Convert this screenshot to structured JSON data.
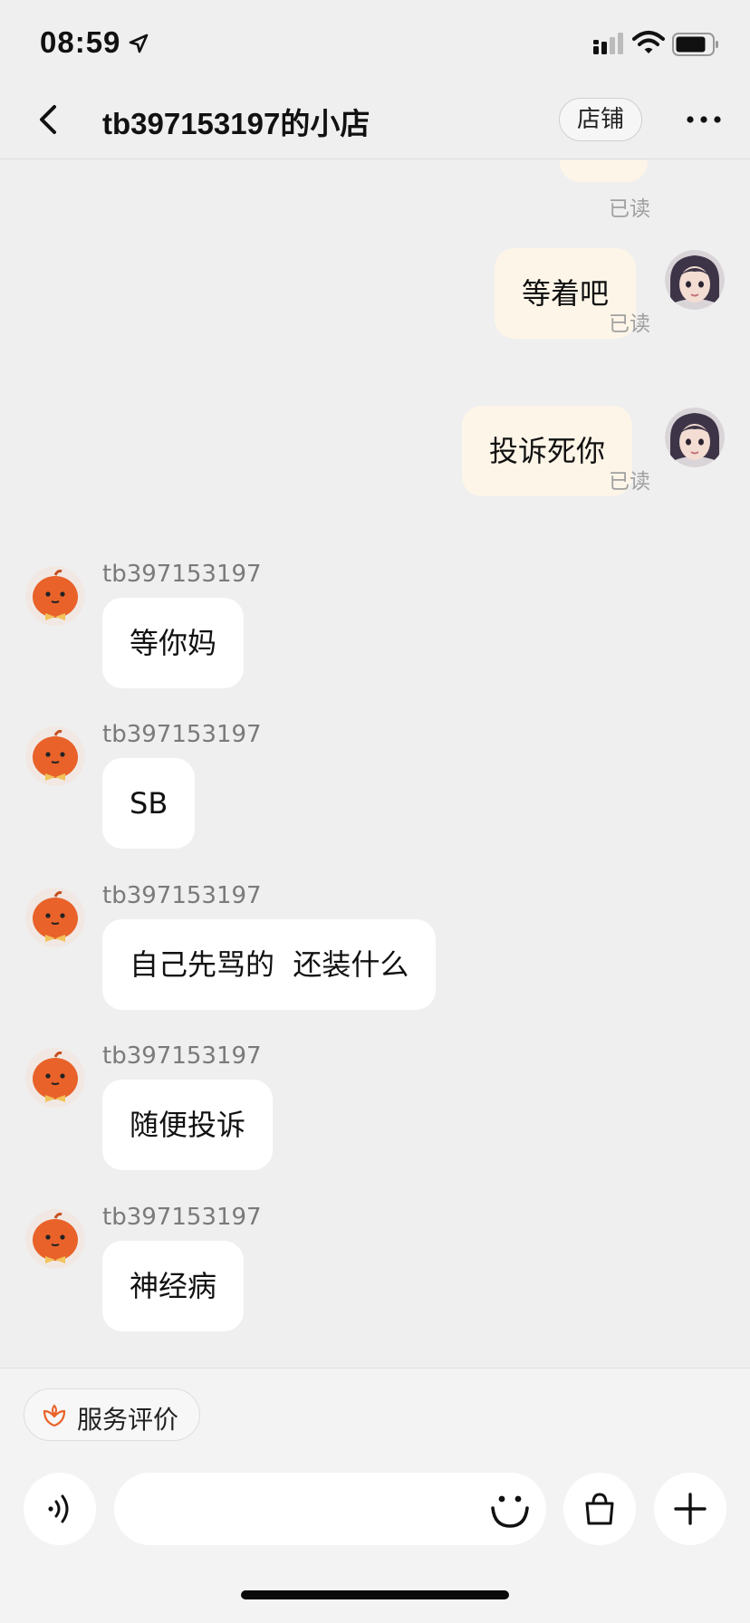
{
  "status_bar": {
    "time": "08:59"
  },
  "header": {
    "title": "tb397153197的小店",
    "shop_button": "店铺"
  },
  "messages": {
    "mine": [
      {
        "text": "",
        "read": "已读"
      },
      {
        "text": "等着吧",
        "read": "已读"
      },
      {
        "text": "投诉死你",
        "read": "已读"
      }
    ],
    "theirs": [
      {
        "sender": "tb397153197",
        "text": "等你妈"
      },
      {
        "sender": "tb397153197",
        "text": "SB"
      },
      {
        "sender": "tb397153197",
        "text": "自己先骂的  还装什么"
      },
      {
        "sender": "tb397153197",
        "text": "随便投诉"
      },
      {
        "sender": "tb397153197",
        "text": "神经病"
      }
    ]
  },
  "bottom": {
    "service_rating": "服务评价",
    "input_value": "",
    "input_placeholder": ""
  },
  "colors": {
    "background": "#efefef",
    "my_bubble": "#fdf5e8",
    "their_bubble": "#ffffff",
    "read_text": "#a0a0a0",
    "accent_orange": "#e8622a"
  },
  "icons": [
    "back-arrow-icon",
    "more-dots-icon",
    "location-arrow-icon",
    "signal-icon",
    "wifi-icon",
    "battery-icon",
    "voice-icon",
    "emoji-icon",
    "shopping-bag-icon",
    "plus-icon",
    "flower-icon"
  ]
}
